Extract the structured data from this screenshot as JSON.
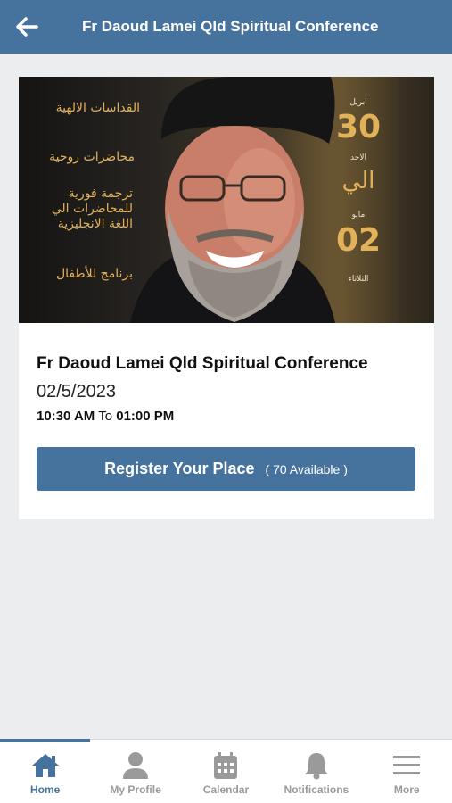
{
  "header": {
    "title": "Fr Daoud Lamei Qld Spiritual Conference",
    "back_icon": "back-arrow-icon"
  },
  "banner": {
    "lines": [
      "القداسات الالهية",
      "محاضرات روحية",
      "ترجمة فورية",
      "للمحاضرات الي",
      "اللغة الانجليزية",
      "برنامج للأطفال"
    ],
    "month_start": "ابريل",
    "day_start": "30",
    "weekday_start": "الاحد",
    "to_word": "الي",
    "month_end": "مايو",
    "day_end": "02",
    "weekday_end": "الثلاثاء"
  },
  "event": {
    "title": "Fr Daoud Lamei Qld Spiritual Conference",
    "date": "02/5/2023",
    "start_time": "10:30 AM",
    "to_label": "To",
    "end_time": "01:00 PM",
    "register_label": "Register Your Place",
    "availability": "( 70 Available )"
  },
  "tabs": [
    {
      "label": "Home",
      "icon": "home-icon",
      "active": true
    },
    {
      "label": "My Profile",
      "icon": "person-icon",
      "active": false
    },
    {
      "label": "Calendar",
      "icon": "calendar-icon",
      "active": false
    },
    {
      "label": "Notifications",
      "icon": "bell-icon",
      "active": false
    },
    {
      "label": "More",
      "icon": "menu-icon",
      "active": false
    }
  ],
  "colors": {
    "primary": "#46739e",
    "gold": "#e2b25a",
    "inactive": "#9a9a9a"
  }
}
